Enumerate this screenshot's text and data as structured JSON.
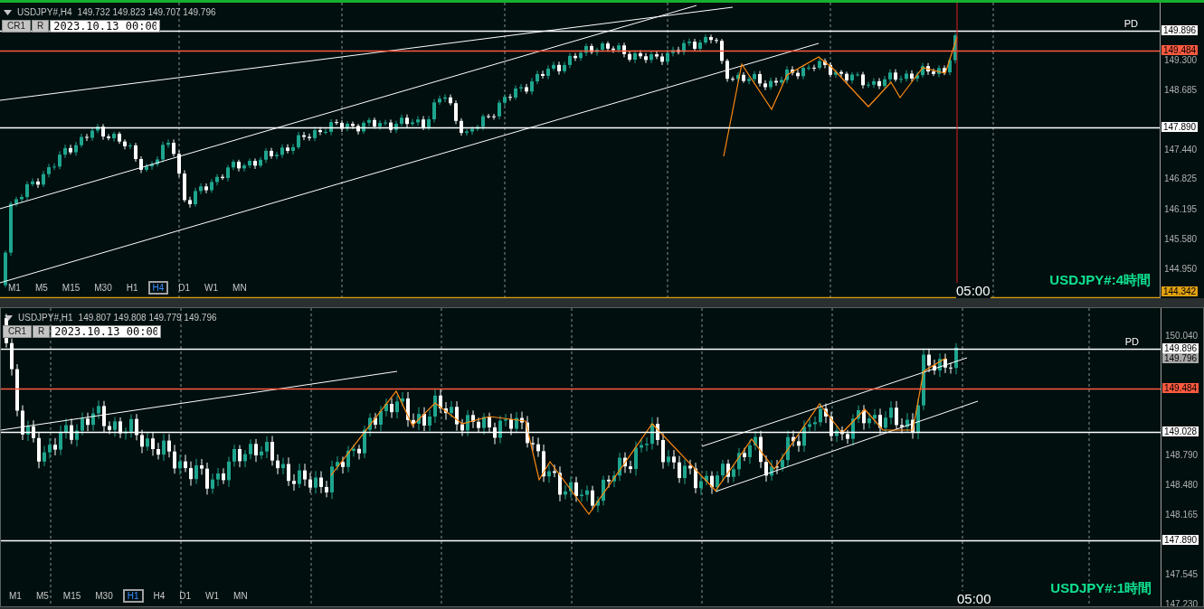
{
  "panels": [
    {
      "active": true,
      "symbol": "USDJPY#,H4",
      "quote": "149.732 149.823 149.707 149.796",
      "buttons": [
        "CR1",
        "R"
      ],
      "date_field": {
        "value": "2023.10.13 00:00"
      },
      "timeframes": [
        {
          "label": "M1",
          "selected": false
        },
        {
          "label": "M5",
          "selected": false
        },
        {
          "label": "M15",
          "selected": false
        },
        {
          "label": "M30",
          "selected": false
        },
        {
          "label": "H1",
          "selected": false
        },
        {
          "label": "H4",
          "selected": true
        },
        {
          "label": "D1",
          "selected": false
        },
        {
          "label": "W1",
          "selected": false
        },
        {
          "label": "MN",
          "selected": false
        }
      ],
      "price_ticks": [
        "149.300",
        "148.685",
        "147.440",
        "146.825",
        "146.195",
        "145.580",
        "144.950"
      ],
      "levels": [
        {
          "kind": "line",
          "price": "149.896",
          "color": "#ffffff",
          "tag": "PD"
        },
        {
          "kind": "line",
          "price": "149.484",
          "color": "#ff5a40"
        },
        {
          "kind": "line",
          "price": "147.890",
          "color": "#ffffff"
        },
        {
          "kind": "line",
          "price": "144.342",
          "color": "#e0a010"
        }
      ],
      "time_label": "05:00",
      "caption": "USDJPY#:4時間"
    },
    {
      "active": false,
      "symbol": "USDJPY#,H1",
      "quote": "149.807 149.808 149.779 149.796",
      "buttons": [
        "CR1",
        "R"
      ],
      "date_field": {
        "value": "2023.10.13 00:00"
      },
      "timeframes": [
        {
          "label": "M1",
          "selected": false
        },
        {
          "label": "M5",
          "selected": false
        },
        {
          "label": "M15",
          "selected": false
        },
        {
          "label": "M30",
          "selected": false
        },
        {
          "label": "H1",
          "selected": true
        },
        {
          "label": "H4",
          "selected": false
        },
        {
          "label": "D1",
          "selected": false
        },
        {
          "label": "W1",
          "selected": false
        },
        {
          "label": "MN",
          "selected": false
        }
      ],
      "price_ticks": [
        "150.040",
        "148.790",
        "148.480",
        "148.165",
        "147.545",
        "147.230"
      ],
      "levels": [
        {
          "kind": "line",
          "price": "149.896",
          "color": "#ffffff",
          "tag": "PD"
        },
        {
          "kind": "bid",
          "price": "149.796",
          "color": "#a8a8a8"
        },
        {
          "kind": "line",
          "price": "149.484",
          "color": "#ff5a40"
        },
        {
          "kind": "line",
          "price": "149.028",
          "color": "#ffffff"
        },
        {
          "kind": "line",
          "price": "147.890",
          "color": "#ffffff"
        }
      ],
      "time_label": "05:00",
      "caption": "USDJPY#:1時間"
    }
  ]
}
